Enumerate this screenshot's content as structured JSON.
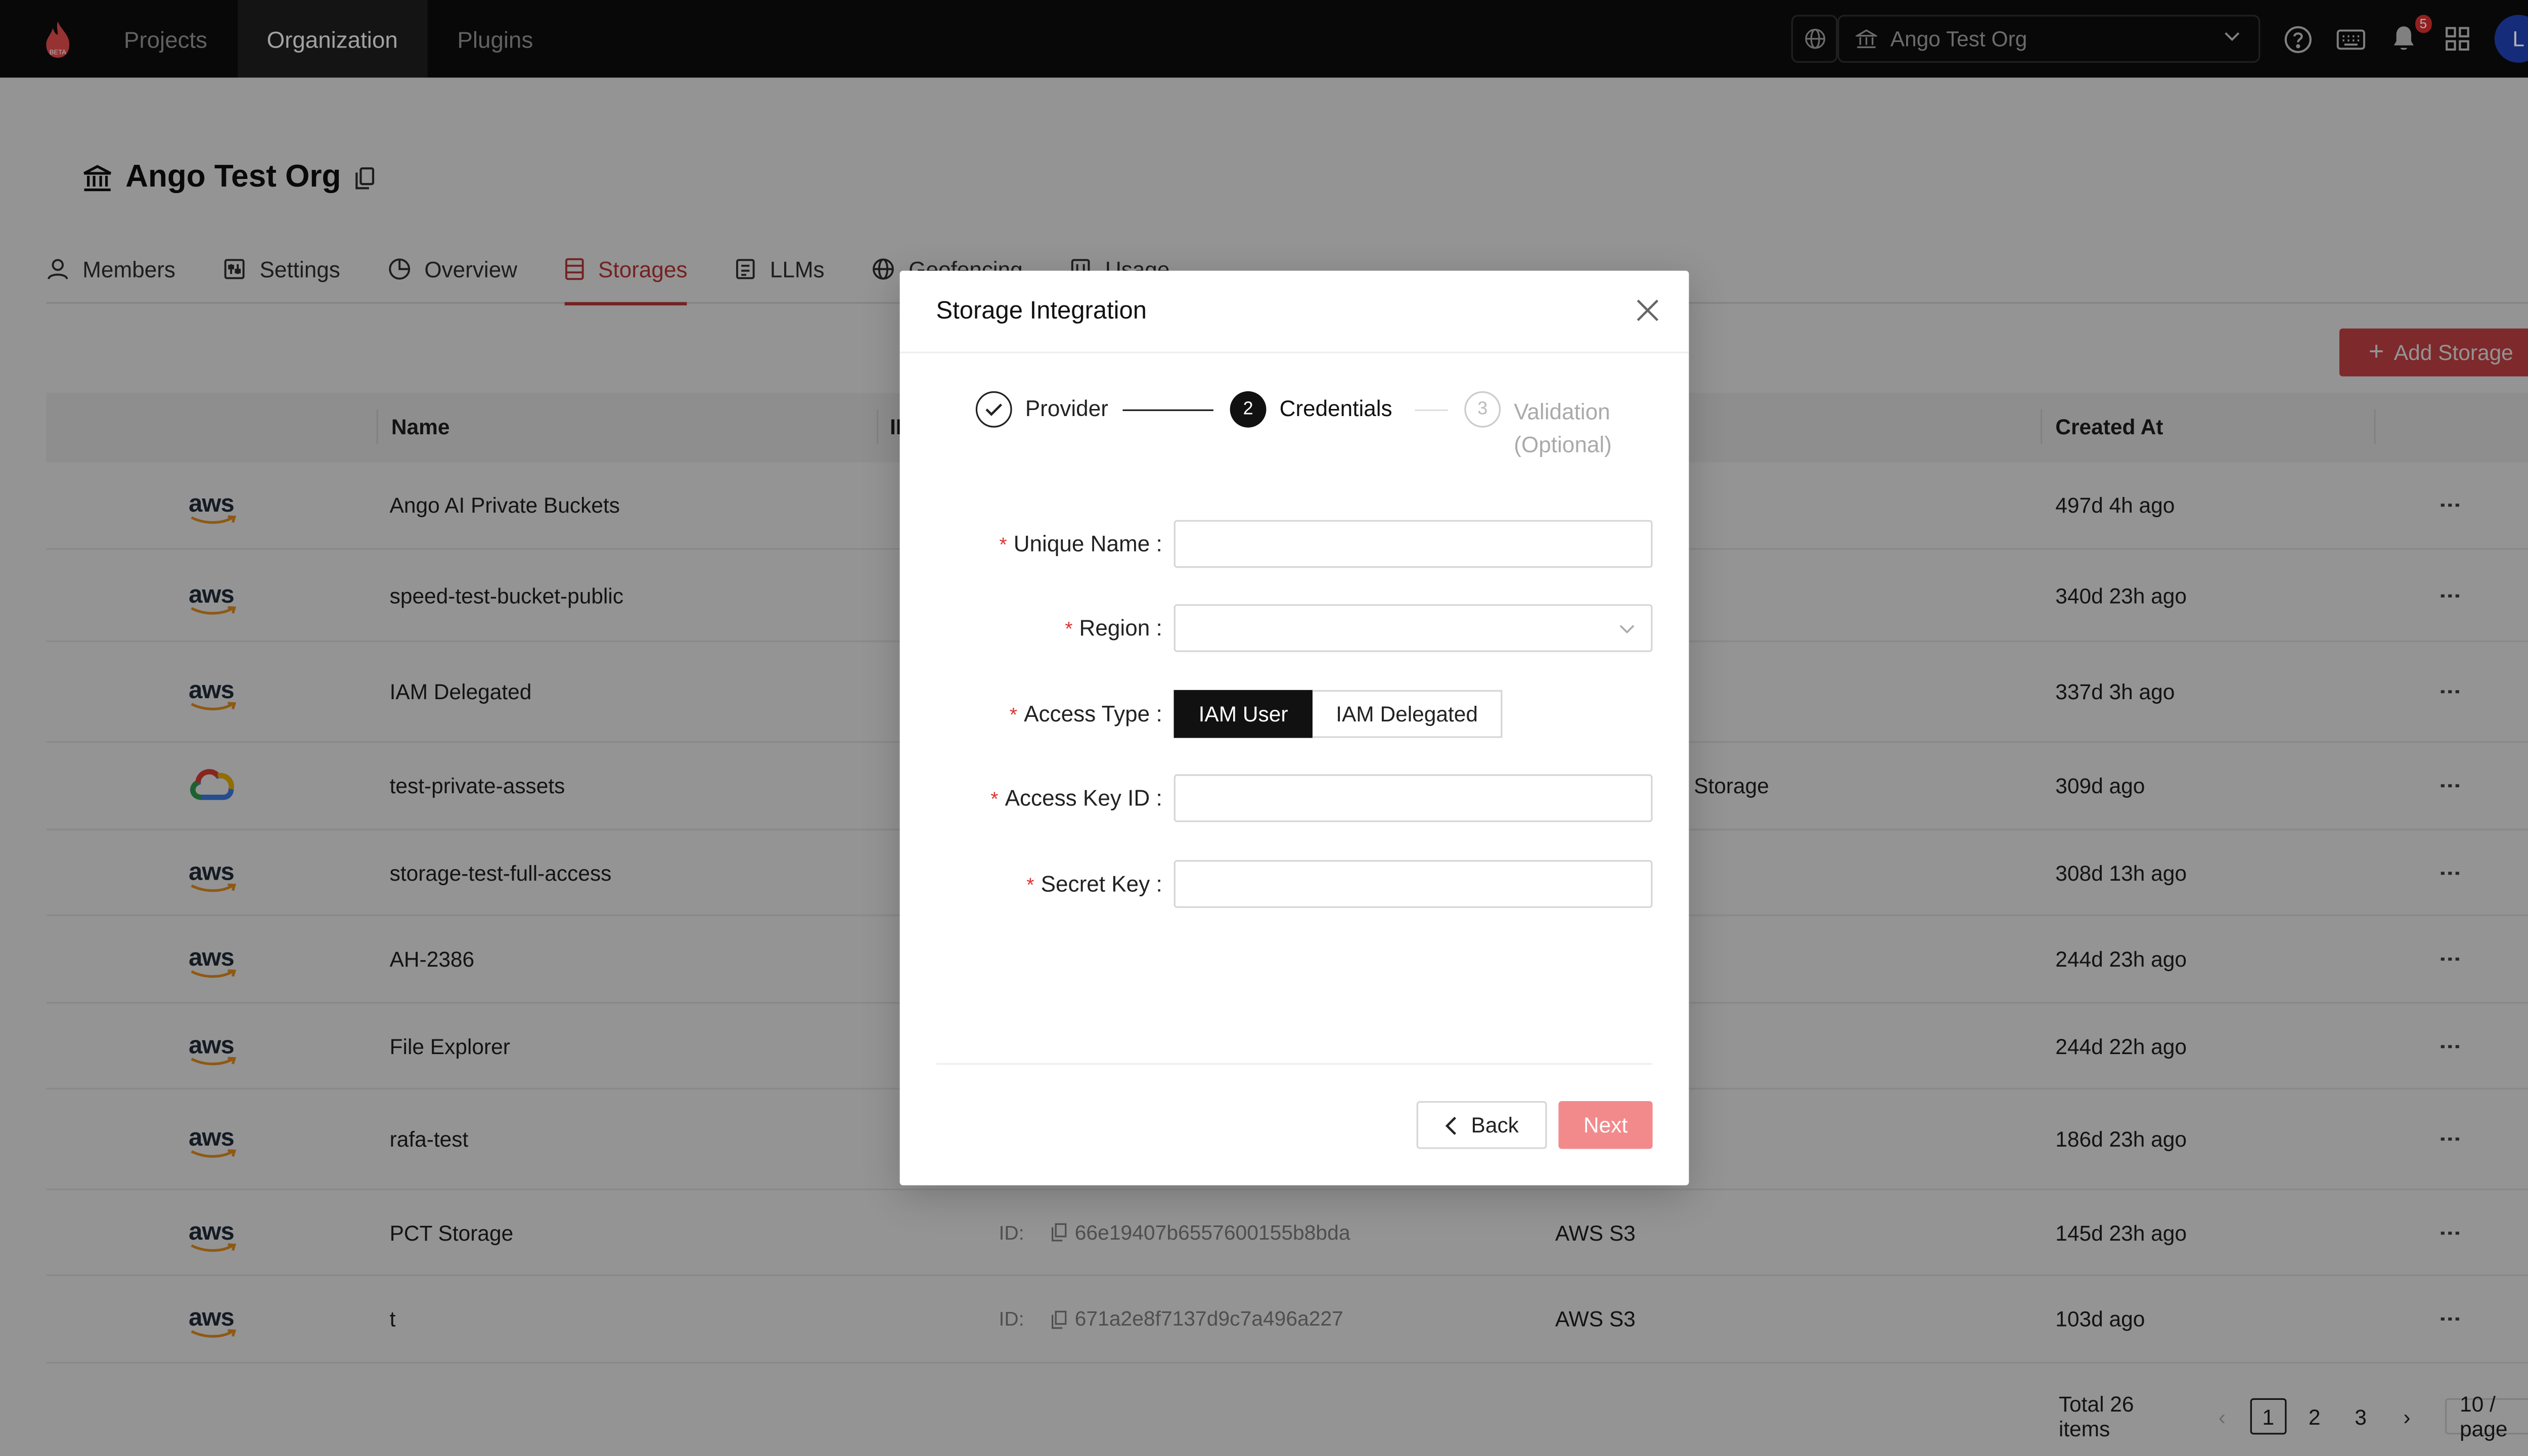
{
  "topbar": {
    "logo_text": "BETA",
    "nav": [
      {
        "label": "Projects"
      },
      {
        "label": "Organization"
      },
      {
        "label": "Plugins"
      }
    ],
    "org_selector": "Ango Test Org",
    "notification_count": "5",
    "avatar_letter": "L"
  },
  "page": {
    "title": "Ango Test Org",
    "tabs": [
      {
        "label": "Members",
        "icon": "user-icon"
      },
      {
        "label": "Settings",
        "icon": "settings-icon"
      },
      {
        "label": "Overview",
        "icon": "pie-chart-icon"
      },
      {
        "label": "Storages",
        "icon": "storage-icon"
      },
      {
        "label": "LLMs",
        "icon": "robot-icon"
      },
      {
        "label": "Geofencing",
        "icon": "globe-icon"
      },
      {
        "label": "Usage",
        "icon": "usage-icon"
      }
    ],
    "add_button": "Add Storage"
  },
  "table": {
    "headers": {
      "name": "Name",
      "id": "ID",
      "created": "Created At"
    },
    "rows": [
      {
        "icon": "aws",
        "name": "Ango AI Private Buckets",
        "id_label": "",
        "id": "",
        "provider": "",
        "created": "497d 4h ago"
      },
      {
        "icon": "aws",
        "name": "speed-test-bucket-public",
        "id_label": "",
        "id": "",
        "provider": "",
        "created": "340d 23h ago"
      },
      {
        "icon": "aws",
        "name": "IAM Delegated",
        "id_label": "",
        "id": "",
        "provider": "",
        "created": "337d 3h ago"
      },
      {
        "icon": "gcp",
        "name": "test-private-assets",
        "id_label": "",
        "id": "",
        "provider": "Storage",
        "created": "309d ago"
      },
      {
        "icon": "aws",
        "name": "storage-test-full-access",
        "id_label": "",
        "id": "",
        "provider": "",
        "created": "308d 13h ago"
      },
      {
        "icon": "aws",
        "name": "AH-2386",
        "id_label": "",
        "id": "",
        "provider": "",
        "created": "244d 23h ago"
      },
      {
        "icon": "aws",
        "name": "File Explorer",
        "id_label": "",
        "id": "",
        "provider": "",
        "created": "244d 22h ago"
      },
      {
        "icon": "aws",
        "name": "rafa-test",
        "id_label": "",
        "id": "",
        "provider": "",
        "created": "186d 23h ago"
      },
      {
        "icon": "aws",
        "name": "PCT Storage",
        "id_label": "ID:",
        "id": "66e19407b6557600155b8bda",
        "provider": "AWS S3",
        "created": "145d 23h ago"
      },
      {
        "icon": "aws",
        "name": "t",
        "id_label": "ID:",
        "id": "671a2e8f7137d9c7a496a227",
        "provider": "AWS S3",
        "created": "103d ago"
      }
    ]
  },
  "pagination": {
    "total": "Total 26 items",
    "pages": [
      "1",
      "2",
      "3"
    ],
    "current": "1",
    "page_size": "10 / page"
  },
  "modal": {
    "title": "Storage Integration",
    "steps": [
      {
        "num": "",
        "label": "Provider",
        "state": "done"
      },
      {
        "num": "2",
        "label": "Credentials",
        "state": "active"
      },
      {
        "num": "3",
        "label": "Validation",
        "sub": "(Optional)",
        "state": "pending"
      }
    ],
    "fields": {
      "unique_name": {
        "label": "Unique Name",
        "value": ""
      },
      "region": {
        "label": "Region",
        "value": ""
      },
      "access_type": {
        "label": "Access Type",
        "options": [
          "IAM User",
          "IAM Delegated"
        ],
        "selected": "IAM User"
      },
      "access_key_id": {
        "label": "Access Key ID",
        "value": ""
      },
      "secret_key": {
        "label": "Secret Key",
        "value": ""
      }
    },
    "back_label": "Back",
    "next_label": "Next"
  },
  "colors": {
    "accent": "#d9484a",
    "topbar": "#0c0c0c",
    "active_tab": "#c83b3b",
    "avatar": "#1f3fb0",
    "next_disabled": "#f28a8c"
  }
}
